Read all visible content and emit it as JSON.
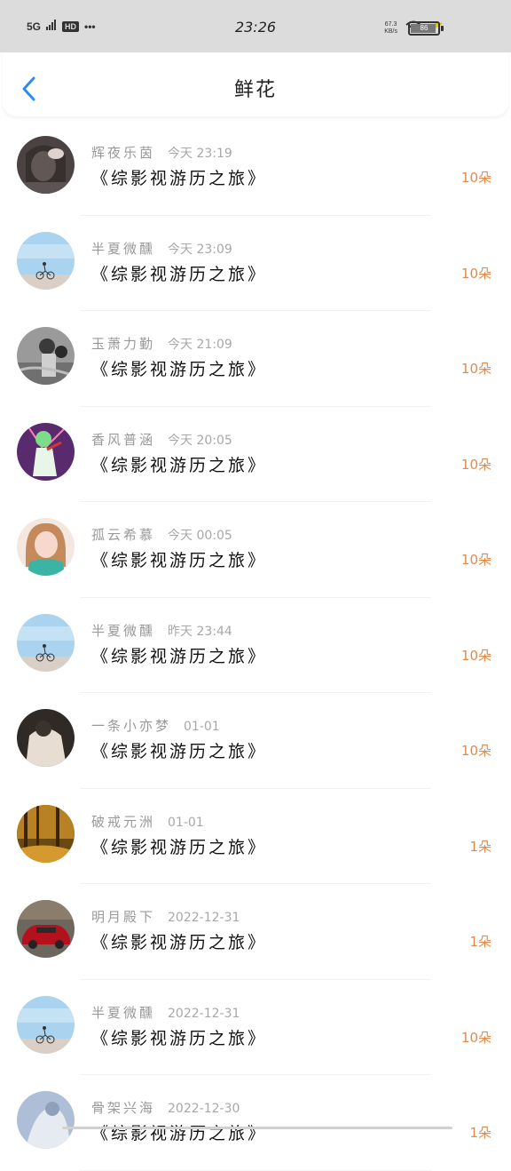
{
  "status_bar": {
    "network": "5G",
    "hd": "HD",
    "dots": "•••",
    "time": "23:26",
    "speed_value": "67.3",
    "speed_unit": "KB/s",
    "battery": "86"
  },
  "header": {
    "title": "鲜花",
    "back_icon": "chevron-left-icon"
  },
  "items": [
    {
      "name": "辉夜乐茵",
      "time": "今天 23:19",
      "book": "《综影视游历之旅》",
      "count": "10朵",
      "avatar": "avatar-girl-hand-bw"
    },
    {
      "name": "半夏微醺",
      "time": "今天 23:09",
      "book": "《综影视游历之旅》",
      "count": "10朵",
      "avatar": "avatar-bicycle-sky"
    },
    {
      "name": "玉萧力勤",
      "time": "今天 21:09",
      "book": "《综影视游历之旅》",
      "count": "10朵",
      "avatar": "avatar-couple-bw"
    },
    {
      "name": "香风普涵",
      "time": "今天 20:05",
      "book": "《综影视游历之旅》",
      "count": "10朵",
      "avatar": "avatar-anime-green"
    },
    {
      "name": "孤云希慕",
      "time": "今天 00:05",
      "book": "《综影视游历之旅》",
      "count": "10朵",
      "avatar": "avatar-girl-pink"
    },
    {
      "name": "半夏微醺",
      "time": "昨天 23:44",
      "book": "《综影视游历之旅》",
      "count": "10朵",
      "avatar": "avatar-bicycle-sky"
    },
    {
      "name": "一条小亦梦",
      "time": "01-01",
      "book": "《综影视游历之旅》",
      "count": "10朵",
      "avatar": "avatar-person-dark"
    },
    {
      "name": "破戒元洲",
      "time": "01-01",
      "book": "《综影视游历之旅》",
      "count": "1朵",
      "avatar": "avatar-autumn-forest"
    },
    {
      "name": "明月殿下",
      "time": "2022-12-31",
      "book": "《综影视游历之旅》",
      "count": "1朵",
      "avatar": "avatar-red-car"
    },
    {
      "name": "半夏微醺",
      "time": "2022-12-31",
      "book": "《综影视游历之旅》",
      "count": "10朵",
      "avatar": "avatar-bicycle-sky"
    },
    {
      "name": "骨架兴海",
      "time": "2022-12-30",
      "book": "《综影视游历之旅》",
      "count": "1朵",
      "avatar": "avatar-pale-figure"
    }
  ],
  "colors": {
    "accent_blue": "#2d8cf0",
    "count_orange": "#e08a4c",
    "meta_gray": "#999999",
    "status_bar_bg": "#dcdcdc"
  }
}
